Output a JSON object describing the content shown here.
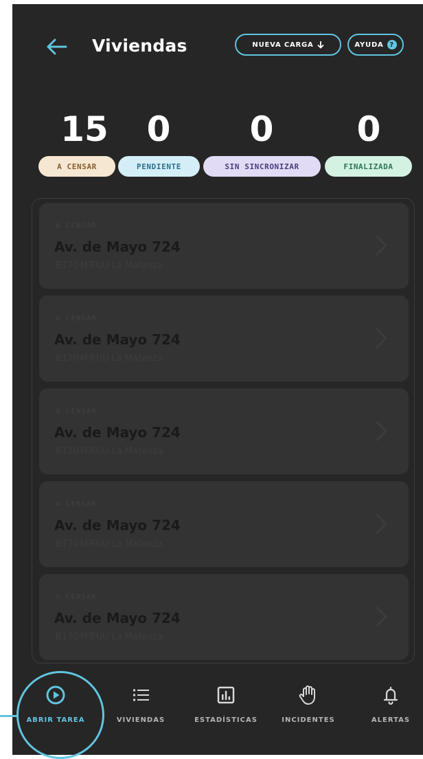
{
  "header": {
    "title": "Viviendas",
    "back_icon": "arrow-left-icon",
    "nueva_carga_label": "NUEVA CARGA",
    "nueva_carga_icon": "arrow-down-icon",
    "ayuda_label": "AYUDA",
    "ayuda_icon": "help-circle-icon",
    "ayuda_glyph": "?"
  },
  "stats": [
    {
      "value": "15",
      "label": "A CENSAR"
    },
    {
      "value": "0",
      "label": "PENDIENTE"
    },
    {
      "value": "0",
      "label": "SIN SINCRONIZAR"
    },
    {
      "value": "0",
      "label": "FINALIZADA"
    }
  ],
  "list": {
    "items": [
      {
        "status": "A CENSAR",
        "address": "Av. de Mayo 724",
        "sub": "B1704FRUU La Matanza"
      },
      {
        "status": "A CENSAR",
        "address": "Av. de Mayo 724",
        "sub": "B1704FRUU La Matanza"
      },
      {
        "status": "A CENSAR",
        "address": "Av. de Mayo 724",
        "sub": "B1704FRUU La Matanza"
      },
      {
        "status": "A CENSAR",
        "address": "Av. de Mayo 724",
        "sub": "B1704FRUU La Matanza"
      },
      {
        "status": "A CENSAR",
        "address": "Av. de Mayo 724",
        "sub": "B1704FRUU La Matanza"
      }
    ]
  },
  "nav": {
    "items": [
      {
        "label": "ABRIR TAREA",
        "icon": "play-circle-icon",
        "active": true
      },
      {
        "label": "VIVIENDAS",
        "icon": "list-icon",
        "active": false
      },
      {
        "label": "ESTADÍSTICAS",
        "icon": "bar-chart-icon",
        "active": false
      },
      {
        "label": "INCIDENTES",
        "icon": "hand-icon",
        "active": false
      },
      {
        "label": "ALERTAS",
        "icon": "bell-icon",
        "active": false
      }
    ]
  },
  "colors": {
    "background": "#262626",
    "accent": "#61c5e0",
    "card": "#333333"
  }
}
